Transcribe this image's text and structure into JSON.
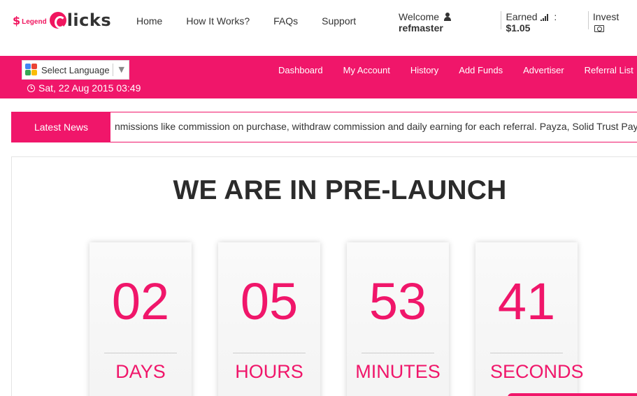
{
  "logo": {
    "s": "$",
    "legend": "Legend",
    "clicks": "licks"
  },
  "topnav": [
    "Home",
    "How It Works?",
    "FAQs",
    "Support"
  ],
  "user": {
    "welcome": "Welcome",
    "username": "refmaster",
    "earned_label": "Earned",
    "earned_sep": ":",
    "earned_value": "$1.05",
    "invest_label": "Invest"
  },
  "language": {
    "label": "Select Language",
    "arrow": "▼"
  },
  "datetime": "Sat, 22 Aug 2015 03:49",
  "mainnav": [
    "Dashboard",
    "My Account",
    "History",
    "Add Funds",
    "Advertiser",
    "Referral List"
  ],
  "news": {
    "label": "Latest News",
    "text": "nmissions like commission on purchase, withdraw commission and daily earning for each referral. Payza, Solid Trust Pay"
  },
  "headline": "WE ARE IN PRE-LAUNCH",
  "countdown": [
    {
      "value": "02",
      "unit": "DAYS"
    },
    {
      "value": "05",
      "unit": "HOURS"
    },
    {
      "value": "53",
      "unit": "MINUTES"
    },
    {
      "value": "41",
      "unit": "SECONDS"
    }
  ],
  "colors": {
    "accent": "#f0166a",
    "text": "#333333"
  }
}
